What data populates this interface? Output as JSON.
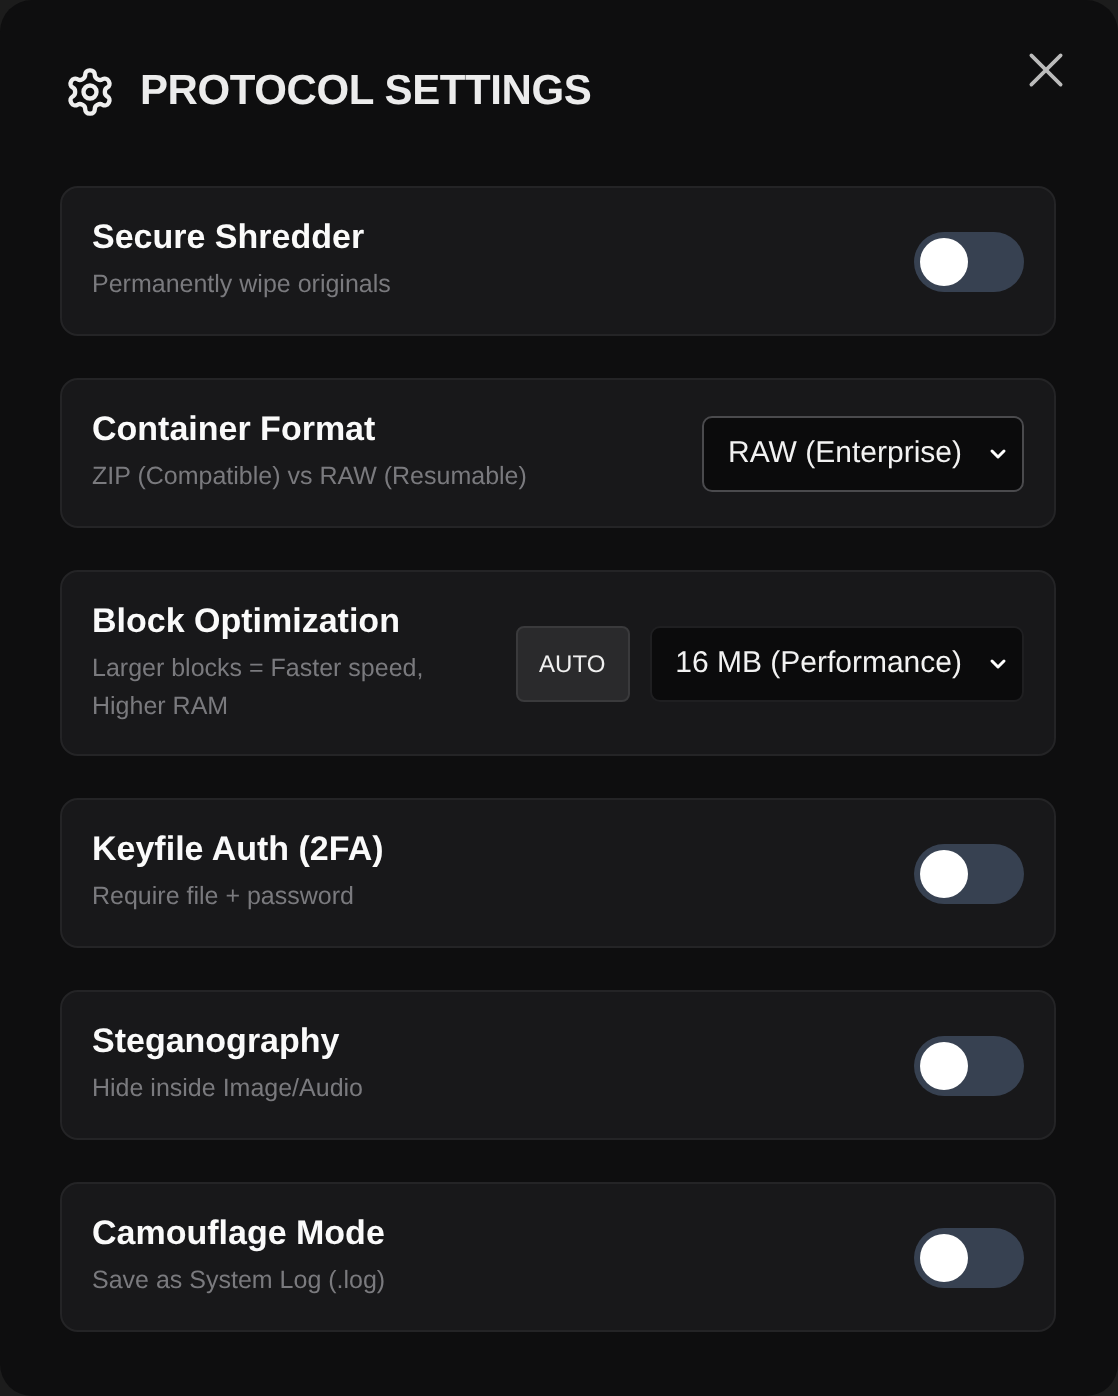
{
  "dialog": {
    "title": "PROTOCOL SETTINGS"
  },
  "settings": [
    {
      "kind": "toggle",
      "name": "Secure Shredder",
      "description": "Permanently wipe originals",
      "on": false
    },
    {
      "kind": "select",
      "name": "Container Format",
      "description": "ZIP (Compatible) vs RAW (Resumable)",
      "value": "RAW (Enterprise)"
    },
    {
      "kind": "select",
      "name": "Block Optimization",
      "description": "Larger blocks = Faster speed, Higher RAM",
      "button": "AUTO",
      "value": "16 MB (Performance)"
    },
    {
      "kind": "toggle",
      "name": "Keyfile Auth (2FA)",
      "description": "Require file + password",
      "on": false
    },
    {
      "kind": "toggle",
      "name": "Steganography",
      "description": "Hide inside Image/Audio",
      "on": false
    },
    {
      "kind": "toggle",
      "name": "Camouflage Mode",
      "description": "Save as System Log (.log)",
      "on": false
    }
  ]
}
